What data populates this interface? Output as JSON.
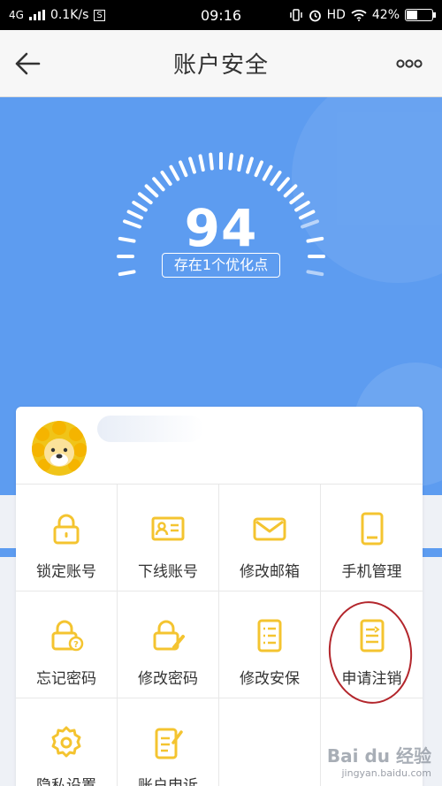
{
  "status_bar": {
    "network": "4G",
    "speed": "0.1K/s",
    "s_badge": "S",
    "time": "09:16",
    "hd": "HD",
    "battery": "42%"
  },
  "nav": {
    "title": "账户安全"
  },
  "security": {
    "score": "94",
    "hint": "存在1个优化点"
  },
  "features": [
    {
      "label": "锁定账号",
      "icon": "lock-icon"
    },
    {
      "label": "下线账号",
      "icon": "id-card-icon"
    },
    {
      "label": "修改邮箱",
      "icon": "mail-icon"
    },
    {
      "label": "手机管理",
      "icon": "phone-icon"
    },
    {
      "label": "忘记密码",
      "icon": "lock-question-icon"
    },
    {
      "label": "修改密码",
      "icon": "lock-edit-icon"
    },
    {
      "label": "修改安保",
      "icon": "list-icon"
    },
    {
      "label": "申请注销",
      "icon": "document-export-icon"
    },
    {
      "label": "隐私设置",
      "icon": "gear-icon"
    },
    {
      "label": "账户申诉",
      "icon": "edit-document-icon"
    }
  ],
  "colors": {
    "accent": "#f4c430",
    "hero_blue": "#5d9cf0",
    "annotation_red": "#b3262c"
  },
  "watermark": {
    "brand": "Bai du 经验",
    "url": "jingyan.baidu.com"
  }
}
